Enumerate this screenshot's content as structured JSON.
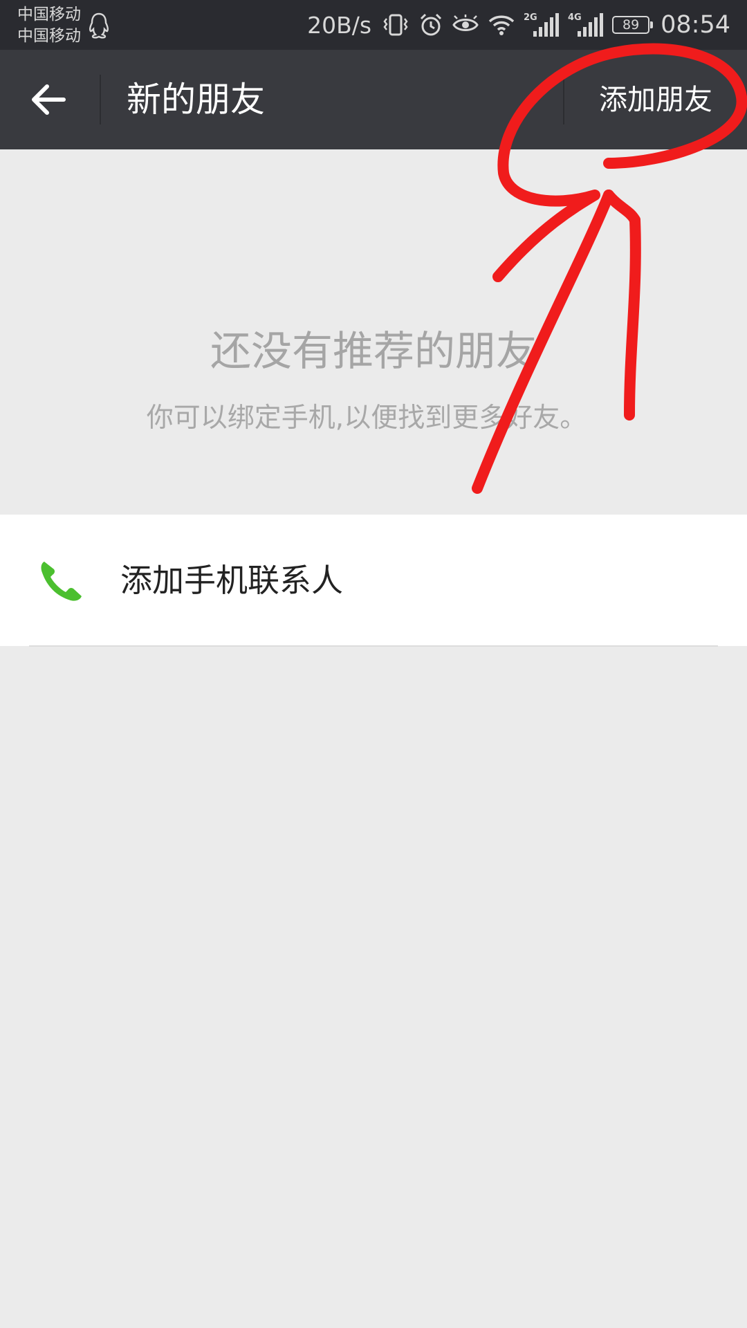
{
  "status_bar": {
    "carrier_1": "中国移动",
    "carrier_2": "中国移动",
    "network_speed": "20B/s",
    "signal_1_label": "2G",
    "signal_2_label": "4G",
    "battery": "89",
    "time": "08:54",
    "icons": [
      "qq-icon",
      "vibrate-icon",
      "alarm-icon",
      "eye-icon",
      "wifi-icon",
      "signal-2g-icon",
      "signal-4g-icon",
      "battery-icon"
    ]
  },
  "action_bar": {
    "back_icon": "back-arrow-icon",
    "title": "新的朋友",
    "add_friend": "添加朋友"
  },
  "empty_state": {
    "title": "还没有推荐的朋友",
    "subtitle": "你可以绑定手机,以便找到更多好友。"
  },
  "list": {
    "items": [
      {
        "icon": "phone-icon",
        "label": "添加手机联系人"
      }
    ]
  },
  "colors": {
    "status_bar_bg": "#2a2b30",
    "action_bar_bg": "#393a3f",
    "page_bg": "#ebebeb",
    "phone_icon": "#4bbf2f",
    "annotation": "#f01c1c"
  }
}
